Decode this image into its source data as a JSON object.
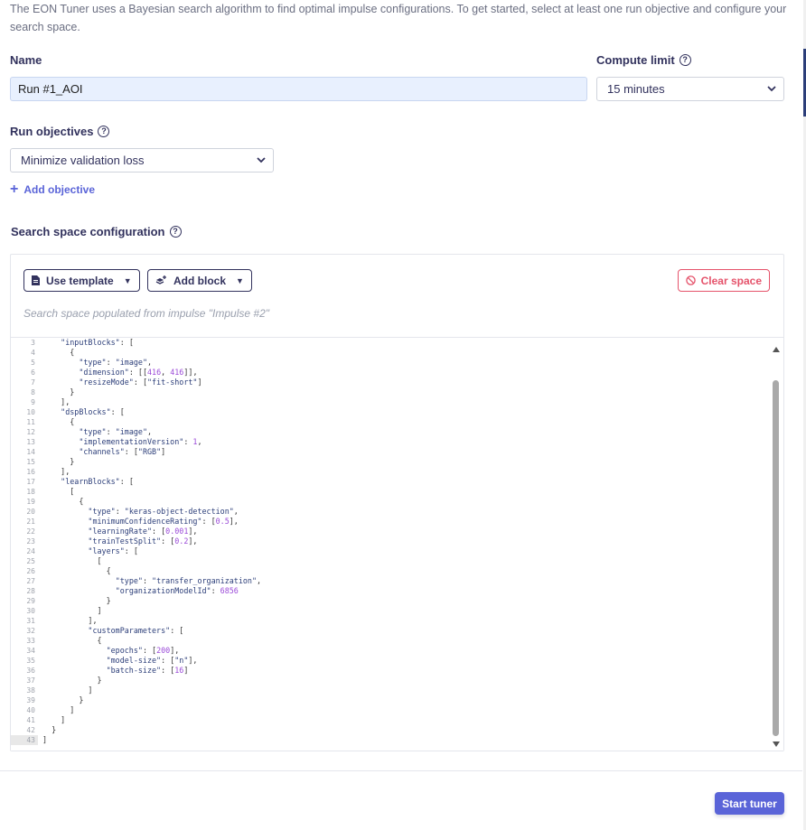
{
  "intro_text": "The EON Tuner uses a Bayesian search algorithm to find optimal impulse configurations. To get started, select at least one run objective and configure your search space.",
  "name": {
    "label": "Name",
    "value": "Run #1_AOI"
  },
  "compute_limit": {
    "label": "Compute limit",
    "selected": "15 minutes"
  },
  "run_objectives": {
    "label": "Run objectives",
    "selected": "Minimize validation loss",
    "add_label": "Add objective"
  },
  "search_space": {
    "label": "Search space configuration",
    "use_template_label": "Use template",
    "add_block_label": "Add block",
    "clear_label": "Clear space",
    "populated_note": "Search space populated from impulse \"Impulse #2\""
  },
  "editor": {
    "line_numbers": [
      "3",
      "4",
      "5",
      "6",
      "7",
      "8",
      "9",
      "10",
      "11",
      "12",
      "13",
      "14",
      "15",
      "16",
      "17",
      "18",
      "19",
      "20",
      "21",
      "22",
      "23",
      "24",
      "25",
      "26",
      "27",
      "28",
      "29",
      "30",
      "31",
      "32",
      "33",
      "34",
      "35",
      "36",
      "37",
      "38",
      "39",
      "40",
      "41",
      "42",
      "43"
    ],
    "lines": [
      "    \"inputBlocks\": [",
      "      {",
      "        \"type\": \"image\",",
      "        \"dimension\": [[416, 416]],",
      "        \"resizeMode\": [\"fit-short\"]",
      "      }",
      "    ],",
      "    \"dspBlocks\": [",
      "      {",
      "        \"type\": \"image\",",
      "        \"implementationVersion\": 1,",
      "        \"channels\": [\"RGB\"]",
      "      }",
      "    ],",
      "    \"learnBlocks\": [",
      "      [",
      "        {",
      "          \"type\": \"keras-object-detection\",",
      "          \"minimumConfidenceRating\": [0.5],",
      "          \"learningRate\": [0.001],",
      "          \"trainTestSplit\": [0.2],",
      "          \"layers\": [",
      "            [",
      "              {",
      "                \"type\": \"transfer_organization\",",
      "                \"organizationModelId\": 6856",
      "              }",
      "            ]",
      "          ],",
      "          \"customParameters\": [",
      "            {",
      "              \"epochs\": [200],",
      "              \"model-size\": [\"n\"],",
      "              \"batch-size\": [16]",
      "            }",
      "          ]",
      "        }",
      "      ]",
      "    ]",
      "  }",
      "]"
    ]
  },
  "start_button_label": "Start tuner",
  "colors": {
    "accent": "#5a64d8",
    "danger": "#e5536b",
    "text": "#32325d",
    "input_bg": "#e8f0fe"
  }
}
